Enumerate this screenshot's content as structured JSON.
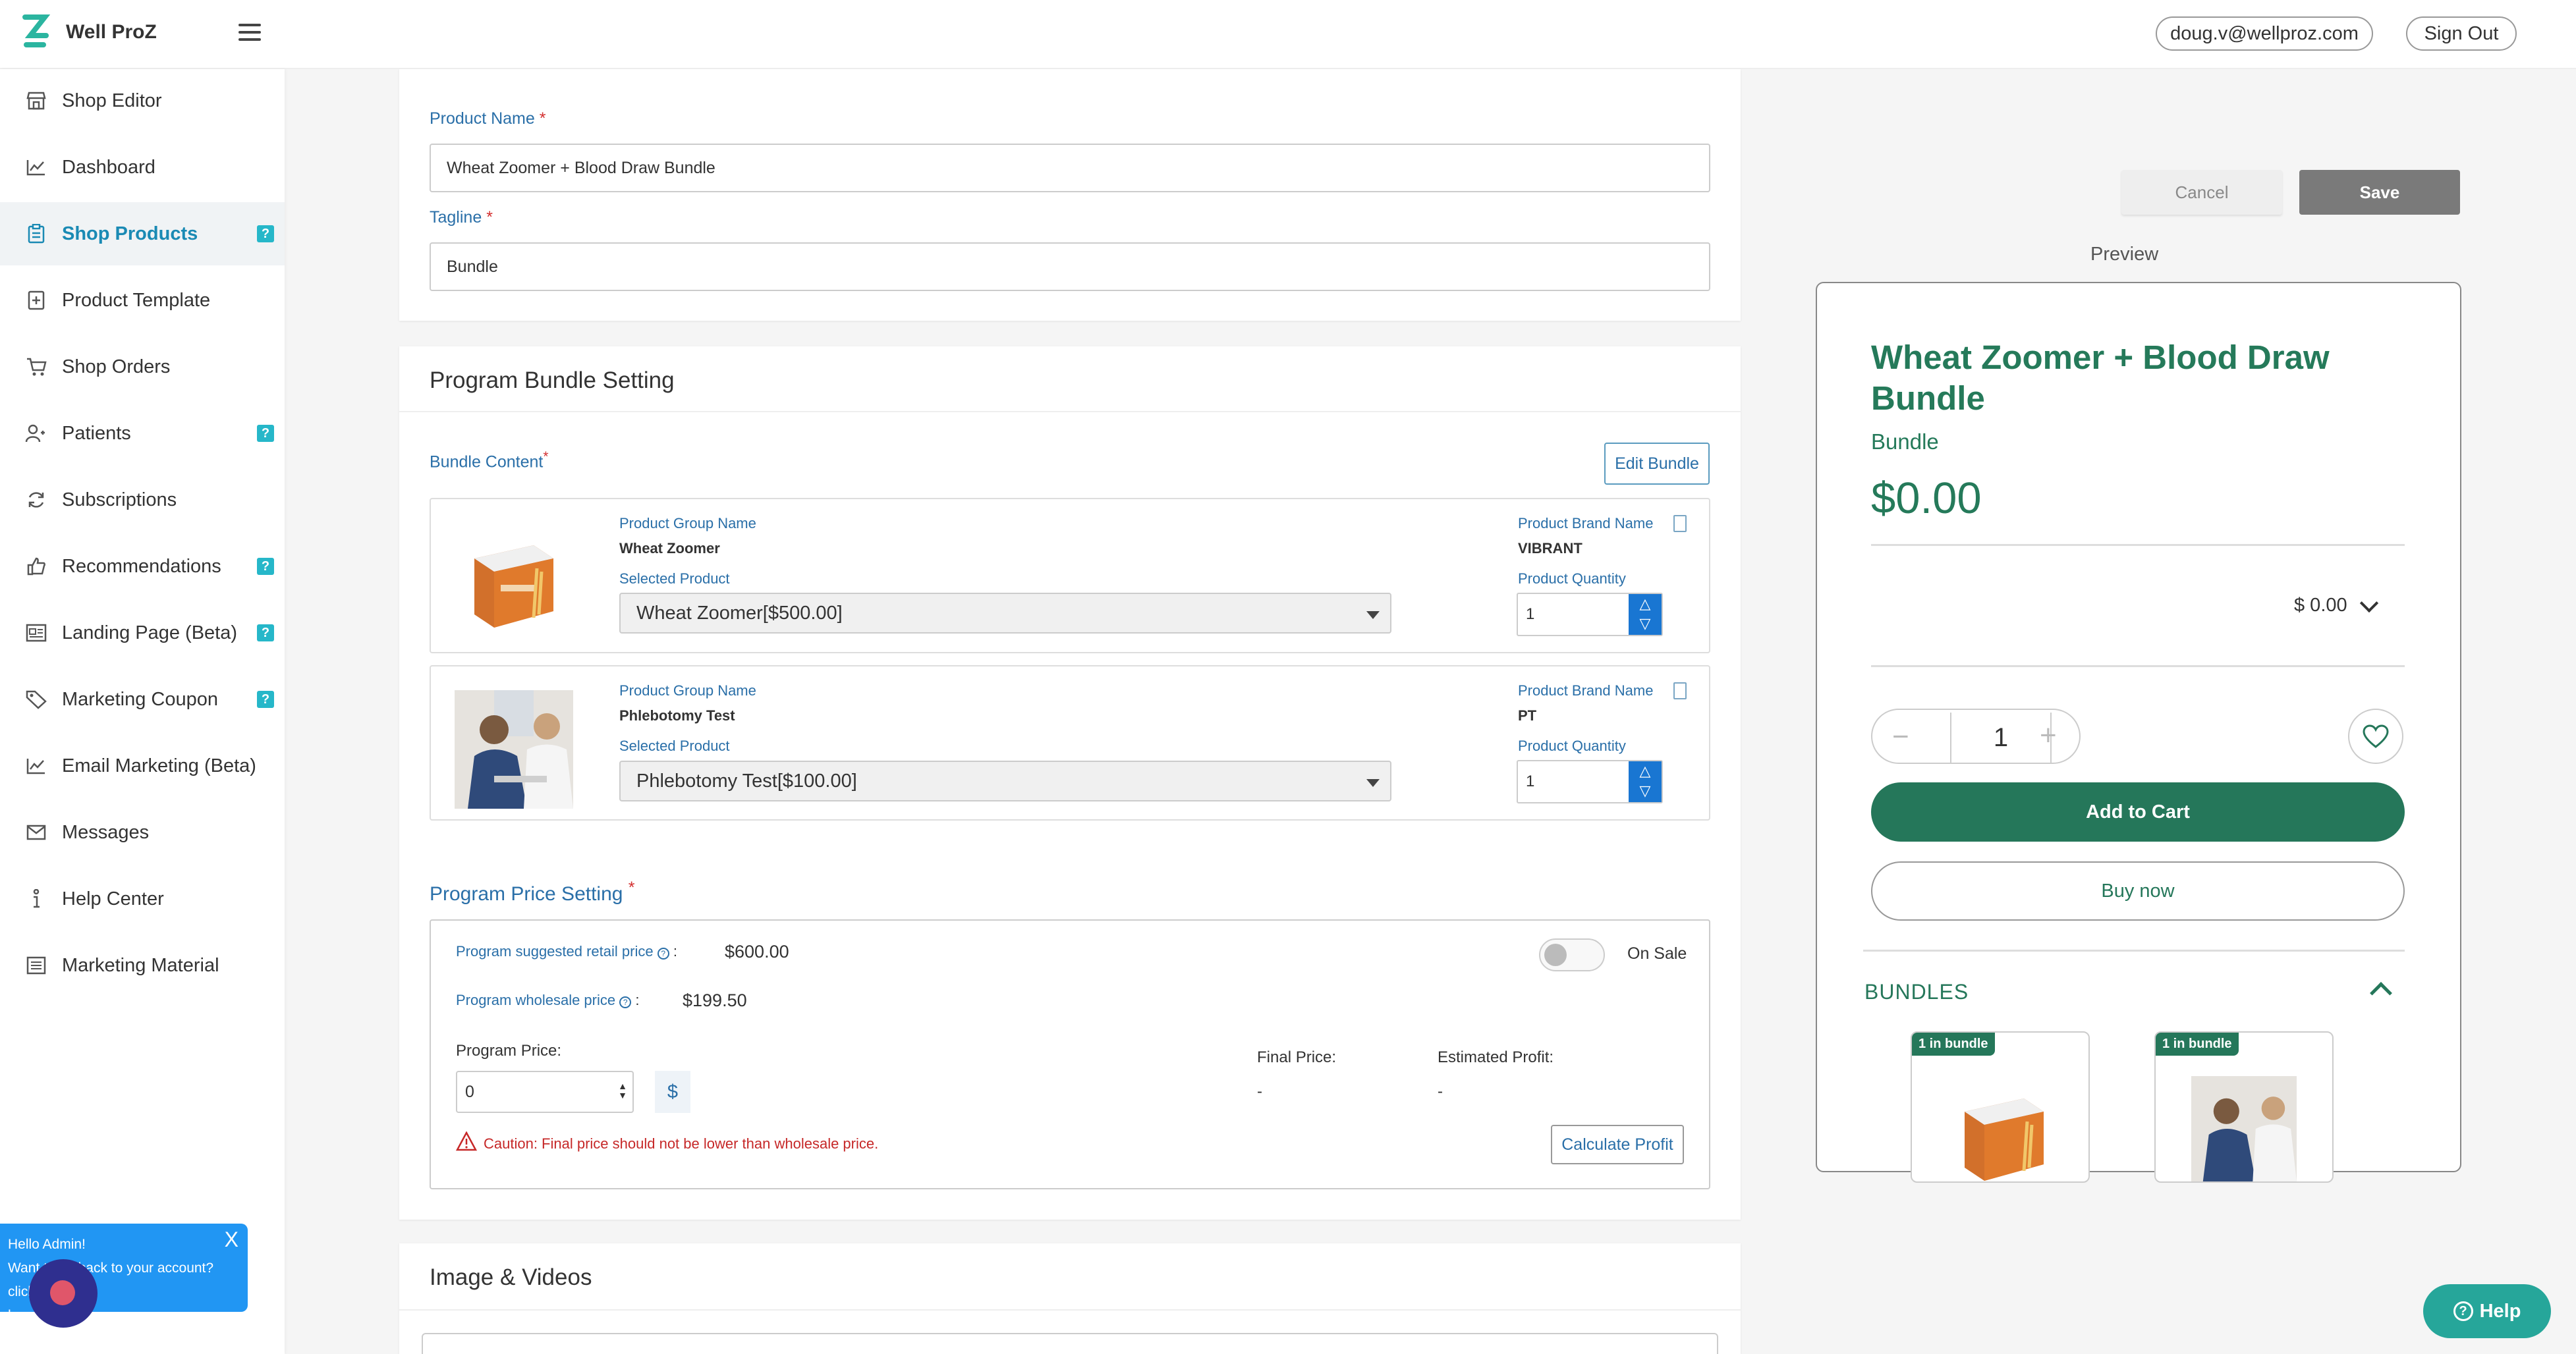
{
  "header": {
    "brand_name": "Well ProZ",
    "user_email": "doug.v@wellproz.com",
    "signout_label": "Sign Out"
  },
  "sidebar": {
    "items": [
      {
        "label": "Shop Editor",
        "icon": "storefront-icon",
        "help": false,
        "active": false
      },
      {
        "label": "Dashboard",
        "icon": "chart-line-icon",
        "help": false,
        "active": false
      },
      {
        "label": "Shop Products",
        "icon": "clipboard-icon",
        "help": true,
        "active": true
      },
      {
        "label": "Product Template",
        "icon": "template-icon",
        "help": false,
        "active": false
      },
      {
        "label": "Shop Orders",
        "icon": "cart-icon",
        "help": false,
        "active": false
      },
      {
        "label": "Patients",
        "icon": "users-icon",
        "help": true,
        "active": false
      },
      {
        "label": "Subscriptions",
        "icon": "refresh-icon",
        "help": false,
        "active": false
      },
      {
        "label": "Recommendations",
        "icon": "thumbs-up-icon",
        "help": true,
        "active": false
      },
      {
        "label": "Landing Page (Beta)",
        "icon": "landing-page-icon",
        "help": true,
        "active": false
      },
      {
        "label": "Marketing Coupon",
        "icon": "tag-icon",
        "help": true,
        "active": false
      },
      {
        "label": "Email Marketing (Beta)",
        "icon": "chart-line-icon",
        "help": false,
        "active": false
      },
      {
        "label": "Messages",
        "icon": "mail-icon",
        "help": false,
        "active": false
      },
      {
        "label": "Help Center",
        "icon": "info-icon",
        "help": false,
        "active": false
      },
      {
        "label": "Marketing Material",
        "icon": "list-icon",
        "help": false,
        "active": false
      }
    ],
    "help_badge": "?"
  },
  "chat": {
    "line1": "Hello Admin!",
    "line2": "Want to go back to your account? click",
    "line3": "here",
    "close": "X"
  },
  "product_form": {
    "name_label": "Product Name",
    "name_value": "Wheat Zoomer + Blood Draw Bundle",
    "tagline_label": "Tagline",
    "tagline_value": "Bundle",
    "required_mark": "*"
  },
  "bundle_section": {
    "title": "Program Bundle Setting",
    "content_label": "Bundle Content",
    "edit_label": "Edit Bundle",
    "group_name_label": "Product Group Name",
    "selected_product_label": "Selected Product",
    "brand_name_label": "Product Brand Name",
    "quantity_label": "Product Quantity",
    "items": [
      {
        "group_name": "Wheat Zoomer",
        "selected": "Wheat Zoomer[$500.00]",
        "brand": "VIBRANT",
        "quantity": "1"
      },
      {
        "group_name": "Phlebotomy Test",
        "selected": "Phlebotomy Test[$100.00]",
        "brand": "PT",
        "quantity": "1"
      }
    ]
  },
  "price_section": {
    "title": "Program Price Setting",
    "retail_label": "Program suggested retail price",
    "retail_value": "$600.00",
    "wholesale_label": "Program wholesale price",
    "wholesale_value": "$199.50",
    "on_sale_label": "On Sale",
    "price_label": "Program Price:",
    "price_value": "0",
    "currency": "$",
    "final_label": "Final Price:",
    "final_value": "-",
    "profit_label": "Estimated Profit:",
    "profit_value": "-",
    "caution": "Caution: Final price should not be lower than wholesale price.",
    "calc_label": "Calculate Profit",
    "colon": ":"
  },
  "media_section": {
    "title": "Image & Videos"
  },
  "actions": {
    "cancel": "Cancel",
    "save": "Save"
  },
  "preview": {
    "label": "Preview",
    "title": "Wheat Zoomer + Blood Draw Bundle",
    "tagline": "Bundle",
    "price": "$0.00",
    "variant_price": "$ 0.00",
    "quantity": "1",
    "add_to_cart": "Add to Cart",
    "buy_now": "Buy now",
    "bundles_label": "BUNDLES",
    "thumbs": [
      {
        "badge": "1 in bundle"
      },
      {
        "badge": "1 in bundle"
      }
    ]
  },
  "help_button": {
    "label": "Help"
  },
  "colors": {
    "brand_green": "#25775a",
    "link_blue": "#2a6fa8",
    "help_teal": "#26b7c9",
    "spinner_blue": "#1976d2",
    "caution_red": "#c62828"
  }
}
